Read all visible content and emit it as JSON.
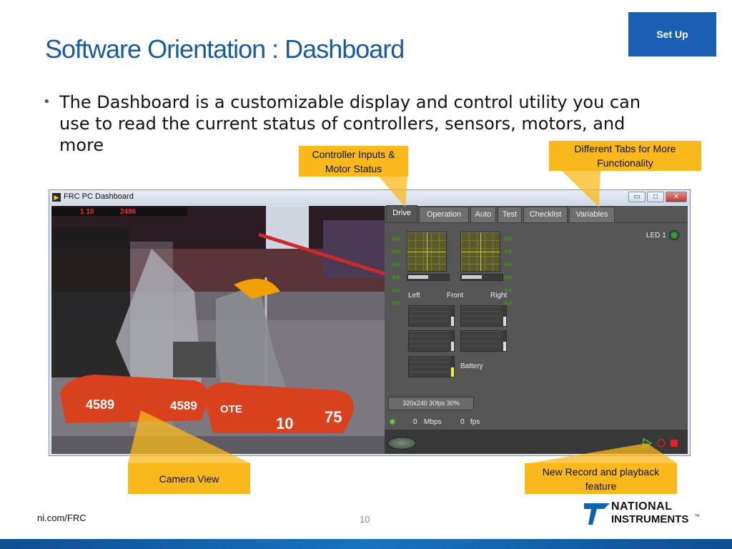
{
  "slide": {
    "title": "Software Orientation : Dashboard",
    "setup_label": "Set Up",
    "bullet_symbol": "•",
    "bullet_text": "The Dashboard is a customizable display and control utility you can use to read the current status of controllers, sensors, motors, and more"
  },
  "callouts": {
    "controller": "Controller Inputs & Motor Status",
    "tabs": "Different Tabs for More Functionality",
    "camera": "Camera  View",
    "record": "New Record and playback feature"
  },
  "window": {
    "title": "FRC PC Dashboard",
    "minimize_glyph": "▭",
    "maximize_glyph": "□",
    "close_glyph": "✕",
    "icon_glyph": "▶"
  },
  "dashboard": {
    "tabs": [
      {
        "label": "Drive",
        "active": true
      },
      {
        "label": "Operation",
        "active": false
      },
      {
        "label": "Auto",
        "active": false
      },
      {
        "label": "Test",
        "active": false
      },
      {
        "label": "Checklist",
        "active": false
      },
      {
        "label": "Variables",
        "active": false
      }
    ],
    "led_label": "LED 1",
    "labels": {
      "left": "Left",
      "front": "Front",
      "right": "Right",
      "battery": "Battery"
    },
    "camera_settings": "320x240   30fps   30%",
    "mbps_value": "0",
    "mbps_unit": "Mbps",
    "fps_value": "0",
    "fps_unit": "fps",
    "joystick_left_fill": 0.5,
    "joystick_right_fill": 0.5,
    "battery_level": 0.45,
    "colors": {
      "record_play": "#2fbf3a",
      "record_stop": "#e82020",
      "led_on": "#2a7a2a"
    }
  },
  "camera": {
    "scoreboard_left": "1 10",
    "scoreboard_mid": "2486",
    "bumper_left": "4589",
    "bumper_left2": "4589",
    "bumper_right": "75",
    "bumper_right2": "10",
    "bumper_right3": "OTE"
  },
  "footer": {
    "url": "ni.com/FRC",
    "page": "10",
    "logo_line1": "NATIONAL",
    "logo_line2": "INSTRUMENTS",
    "tm": "™"
  }
}
